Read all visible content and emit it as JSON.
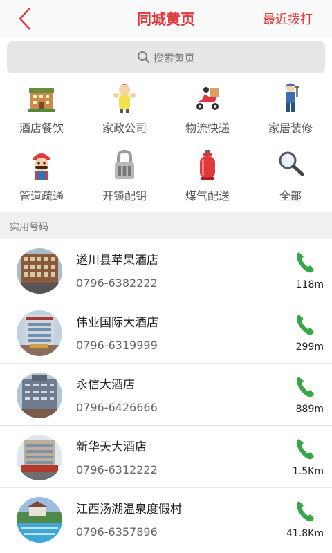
{
  "header": {
    "title": "同城黄页",
    "recent_label": "最近拨打"
  },
  "search": {
    "placeholder": "搜索黄页"
  },
  "categories": [
    {
      "label": "酒店餐饮",
      "icon": "hotel-building-icon"
    },
    {
      "label": "家政公司",
      "icon": "housekeeper-icon"
    },
    {
      "label": "物流快递",
      "icon": "delivery-scooter-icon"
    },
    {
      "label": "家居装修",
      "icon": "repairman-icon"
    },
    {
      "label": "管道疏通",
      "icon": "plumber-icon"
    },
    {
      "label": "开锁配钥",
      "icon": "padlock-icon"
    },
    {
      "label": "煤气配送",
      "icon": "gas-cylinder-icon"
    },
    {
      "label": "全部",
      "icon": "magnifier-icon"
    }
  ],
  "section": {
    "title": "实用号码"
  },
  "entries": [
    {
      "name": "遂川县苹果酒店",
      "phone": "0796-6382222",
      "distance": "118m"
    },
    {
      "name": "伟业国际大酒店",
      "phone": "0796-6319999",
      "distance": "299m"
    },
    {
      "name": "永信大酒店",
      "phone": "0796-6426666",
      "distance": "889m"
    },
    {
      "name": "新华天大酒店",
      "phone": "0796-6312222",
      "distance": "1.5Km"
    },
    {
      "name": "江西汤湖温泉度假村",
      "phone": "0796-6357896",
      "distance": "41.8Km"
    }
  ],
  "colors": {
    "accent": "#e0393d",
    "call_green": "#3aa64a",
    "section_bg": "#f0f0f2"
  }
}
